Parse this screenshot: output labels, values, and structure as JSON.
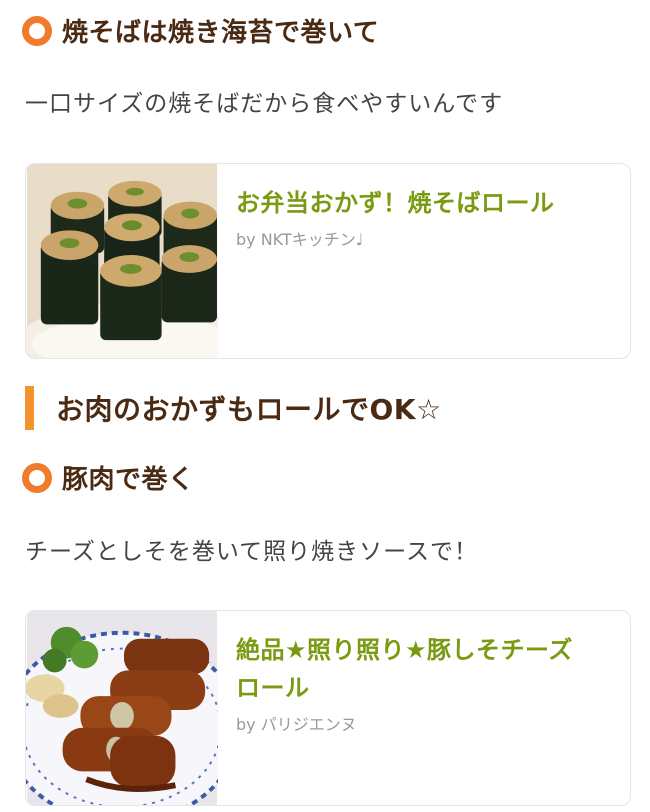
{
  "section1": {
    "heading": "焼そばは焼き海苔で巻いて",
    "description": "一口サイズの焼そばだから食べやすいんです",
    "card": {
      "title": "お弁当おかず！焼そばロール",
      "author": "by NKTキッチン♩"
    }
  },
  "section2": {
    "heading": "お肉のおかずもロールでOK☆"
  },
  "section3": {
    "heading": "豚肉で巻く",
    "description": "チーズとしそを巻いて照り焼きソースで！",
    "card": {
      "title_line1": "絶品★照り照り★豚しそチーズ",
      "title_line2": "ロール",
      "author": "by パリジエンヌ"
    }
  },
  "colors": {
    "accent_orange": "#f07b2b",
    "heading_brown": "#4a2a12",
    "recipe_green": "#7a9a12"
  },
  "icons": {
    "heading_marker": "orange-ring-icon",
    "section_marker": "orange-bar-icon"
  }
}
